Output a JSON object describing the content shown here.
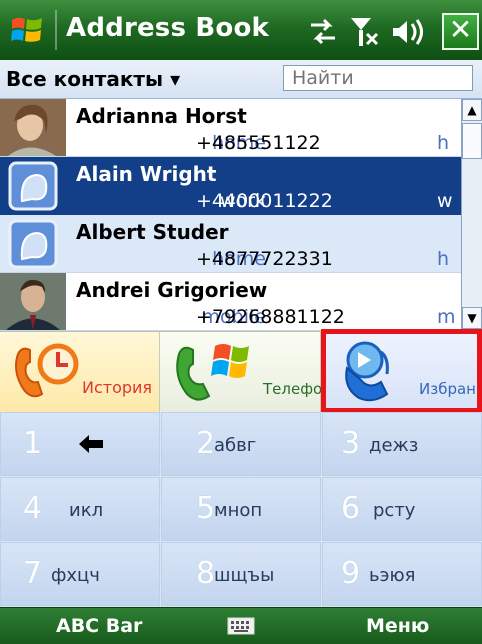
{
  "titlebar": {
    "title": "Address Book",
    "close": "✕"
  },
  "filter": {
    "dropdown": "Все контакты ▾",
    "search_placeholder": "Найти"
  },
  "contacts": [
    {
      "name": "Adrianna Horst",
      "phone_type": "home",
      "phone": "+485551122",
      "tag": "h",
      "selected": false
    },
    {
      "name": "Alain Wright",
      "phone_type": "work",
      "phone": "+4400011222",
      "tag": "w",
      "selected": true
    },
    {
      "name": "Albert Studer",
      "phone_type": "home",
      "phone": "+4877722331",
      "tag": "h",
      "selected": false
    },
    {
      "name": "Andrei Grigoriew",
      "phone_type": "mobile",
      "phone": "+79268881122",
      "tag": "m",
      "selected": false
    }
  ],
  "tabs": {
    "history": "История",
    "phone": "Телефон",
    "favorites": "Избранное"
  },
  "dialpad": [
    {
      "num": "1",
      "letters": ""
    },
    {
      "num": "2",
      "letters": "абвг"
    },
    {
      "num": "3",
      "letters": "дежз"
    },
    {
      "num": "4",
      "letters": "икл"
    },
    {
      "num": "5",
      "letters": "мноп"
    },
    {
      "num": "6",
      "letters": "рсту"
    },
    {
      "num": "7",
      "letters": "фхцч"
    },
    {
      "num": "8",
      "letters": "шщъы"
    },
    {
      "num": "9",
      "letters": "ьэюя"
    }
  ],
  "softkeys": {
    "left": "ABC Bar",
    "right": "Меню"
  },
  "colors": {
    "accent_green": "#1f6a23",
    "selection_blue": "#123f87",
    "highlight_red": "#e8141c"
  }
}
